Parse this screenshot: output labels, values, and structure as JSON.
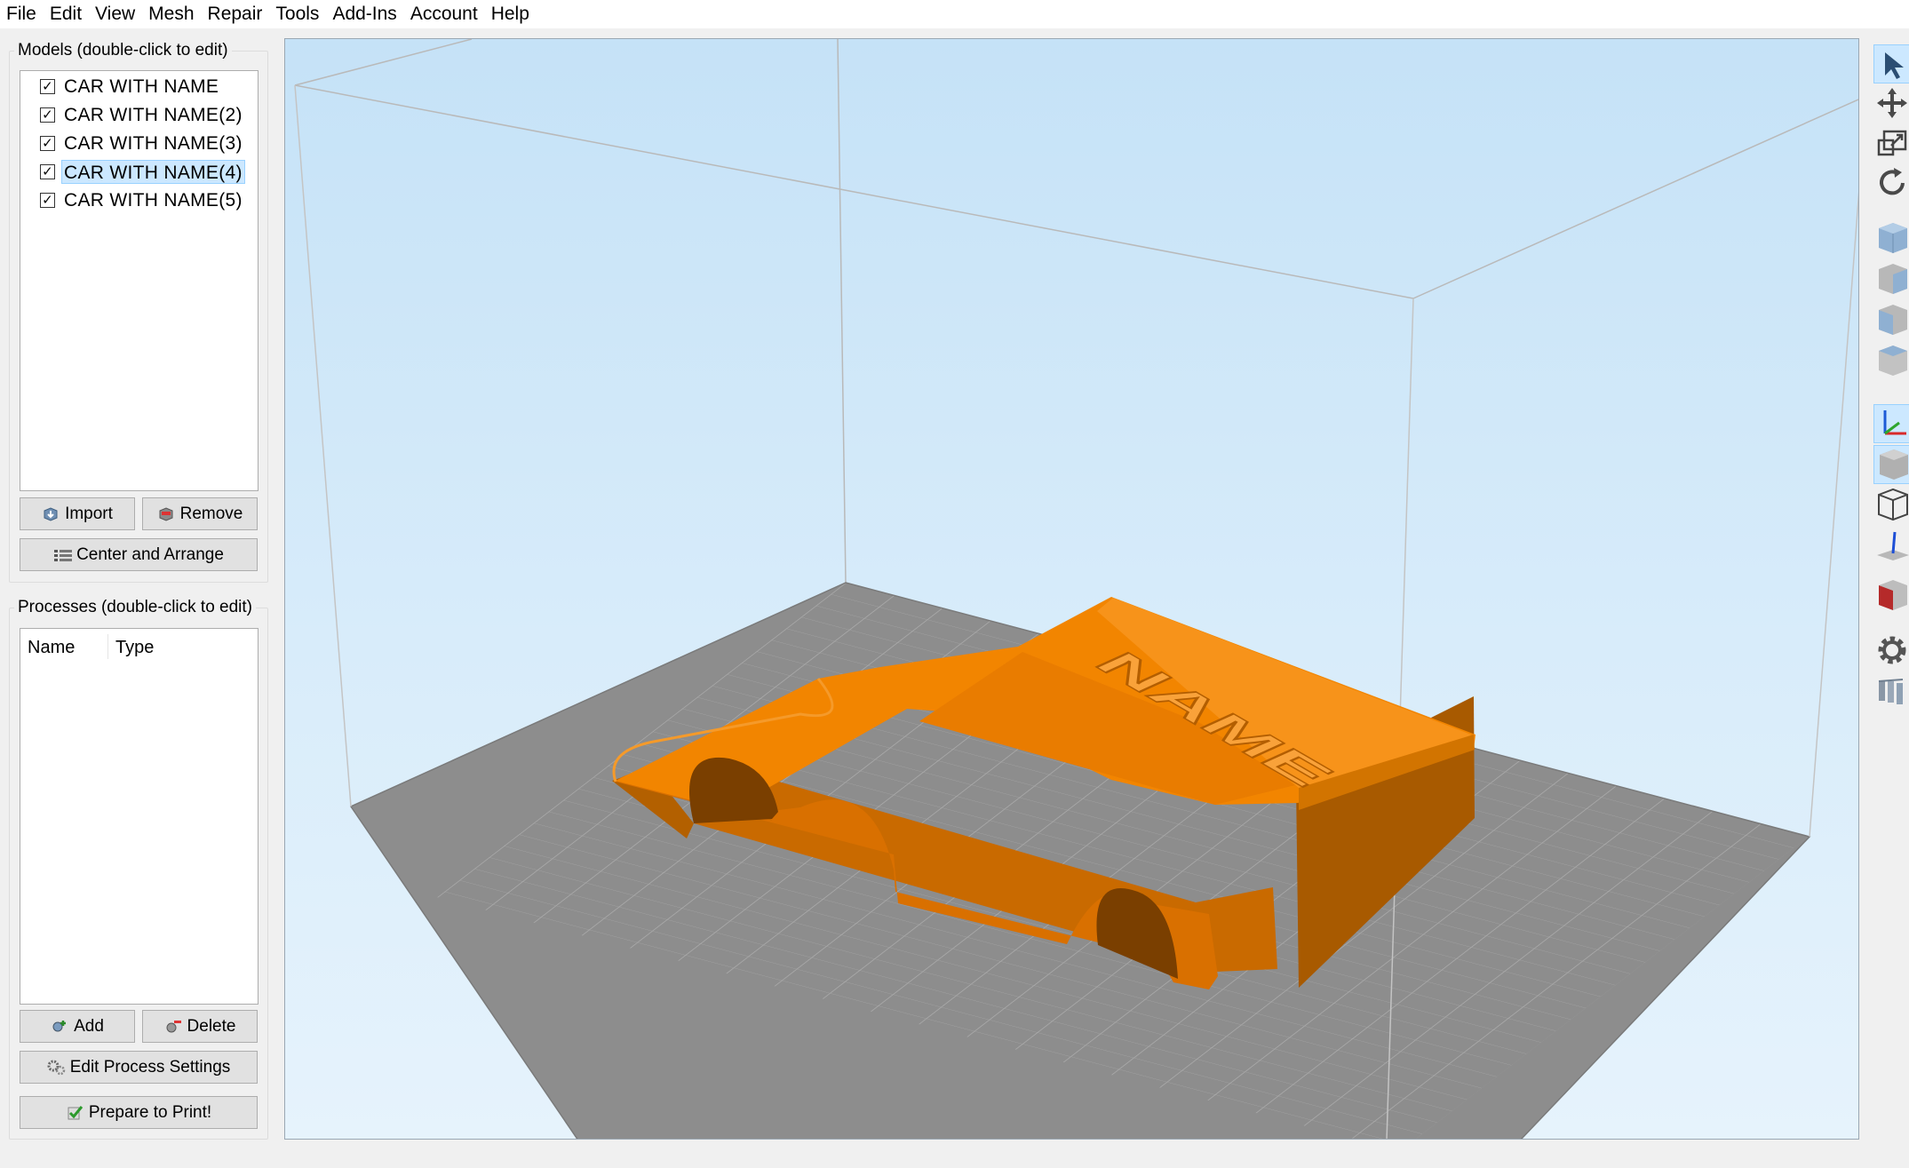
{
  "menu": [
    "File",
    "Edit",
    "View",
    "Mesh",
    "Repair",
    "Tools",
    "Add-Ins",
    "Account",
    "Help"
  ],
  "models": {
    "title": "Models (double-click to edit)",
    "items": [
      {
        "label": "CAR WITH NAME",
        "checked": true,
        "selected": false
      },
      {
        "label": "CAR WITH NAME(2)",
        "checked": true,
        "selected": false
      },
      {
        "label": "CAR WITH NAME(3)",
        "checked": true,
        "selected": false
      },
      {
        "label": "CAR WITH NAME(4)",
        "checked": true,
        "selected": true
      },
      {
        "label": "CAR WITH NAME(5)",
        "checked": true,
        "selected": false
      }
    ],
    "import_label": "Import",
    "remove_label": "Remove",
    "center_label": "Center and Arrange"
  },
  "processes": {
    "title": "Processes (double-click to edit)",
    "columns": [
      "Name",
      "Type"
    ],
    "add_label": "Add",
    "delete_label": "Delete",
    "edit_label": "Edit Process Settings",
    "prepare_label": "Prepare to Print!"
  },
  "scene": {
    "model_text": "NAME",
    "model_color": "#e67a00",
    "bed_color": "#8d8d8d",
    "grid_color": "#a9a9a9",
    "background_color": "#c9e4f8"
  },
  "toolbar": [
    {
      "icon": "select-arrow-icon",
      "active": true
    },
    {
      "icon": "move-icon",
      "active": false
    },
    {
      "icon": "scale-icon",
      "active": false
    },
    {
      "icon": "rotate-icon",
      "active": false
    },
    {
      "icon": "view-iso-cube-icon",
      "active": false
    },
    {
      "icon": "view-front-cube-icon",
      "active": false
    },
    {
      "icon": "view-side-cube-icon",
      "active": false
    },
    {
      "icon": "view-top-cube-icon",
      "active": false
    },
    {
      "icon": "axes-icon",
      "active": true
    },
    {
      "icon": "solid-cube-icon",
      "active": true
    },
    {
      "icon": "wireframe-cube-icon",
      "active": false
    },
    {
      "icon": "normal-vector-icon",
      "active": false
    },
    {
      "icon": "section-cube-icon",
      "active": false
    },
    {
      "icon": "settings-gear-icon",
      "active": false
    },
    {
      "icon": "supports-icon",
      "active": false
    }
  ]
}
